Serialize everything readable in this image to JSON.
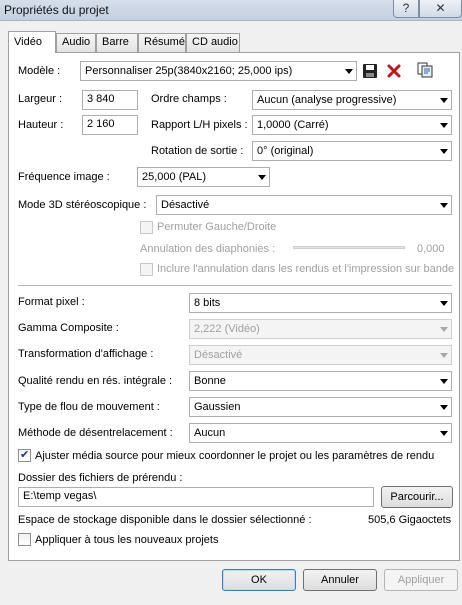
{
  "window": {
    "title": "Propriétés du projet",
    "help_label": "?",
    "close_label": "✕"
  },
  "tabs": [
    {
      "label": "Vidéo",
      "active": true
    },
    {
      "label": "Audio",
      "active": false
    },
    {
      "label": "Barre",
      "active": false
    },
    {
      "label": "Résumé",
      "active": false
    },
    {
      "label": "CD audio",
      "active": false
    }
  ],
  "template": {
    "label": "Modèle :",
    "value": "Personnaliser 25p(3840x2160; 25,000 ips)",
    "save_icon": "floppy-disk-icon",
    "delete_icon": "red-x-icon",
    "copy_icon": "copy-info-icon"
  },
  "width": {
    "label": "Largeur :",
    "value": "3 840"
  },
  "height": {
    "label": "Hauteur :",
    "value": "2 160"
  },
  "field_order": {
    "label": "Ordre champs :",
    "value": "Aucun (analyse progressive)"
  },
  "pixel_aspect": {
    "label": "Rapport L/H pixels :",
    "value": "1,0000 (Carré)"
  },
  "rotation": {
    "label": "Rotation de sortie :",
    "value": "0° (original)"
  },
  "frame_rate": {
    "label": "Fréquence image :",
    "value": "25,000 (PAL)"
  },
  "stereo3d": {
    "label": "Mode 3D stéréoscopique :",
    "value": "Désactivé"
  },
  "swap_lr": {
    "label": "Permuter Gauche/Droite",
    "checked": false
  },
  "crosstalk": {
    "label": "Annulation des diaphonies :",
    "value": "0,000"
  },
  "include_crosstalk": {
    "label": "Inclure l'annulation dans les rendus et l'impression sur bande",
    "checked": false
  },
  "pixel_format": {
    "label": "Format pixel :",
    "value": "8 bits"
  },
  "gamma": {
    "label": "Gamma Composite :",
    "value": "2,222 (Vidéo)"
  },
  "view_transform": {
    "label": "Transformation d'affichage :",
    "value": "Désactivé"
  },
  "render_quality": {
    "label": "Qualité rendu en rés. intégrale :",
    "value": "Bonne"
  },
  "motion_blur": {
    "label": "Type de flou de mouvement :",
    "value": "Gaussien"
  },
  "deinterlace": {
    "label": "Méthode de désentrelacement :",
    "value": "Aucun"
  },
  "adjust_media": {
    "label": "Ajuster média source pour mieux coordonner le projet ou les paramètres de rendu",
    "checked": true
  },
  "prerender": {
    "label": "Dossier des fichiers de prérendu :",
    "value": "E:\\temp vegas\\",
    "browse_label": "Parcourir..."
  },
  "storage": {
    "label": "Espace de stockage disponible dans le dossier sélectionné :",
    "value": "505,6 Gigaoctets"
  },
  "apply_all": {
    "label": "Appliquer à tous les nouveaux projets",
    "checked": false
  },
  "buttons": {
    "ok": "OK",
    "cancel": "Annuler",
    "apply": "Appliquer"
  }
}
